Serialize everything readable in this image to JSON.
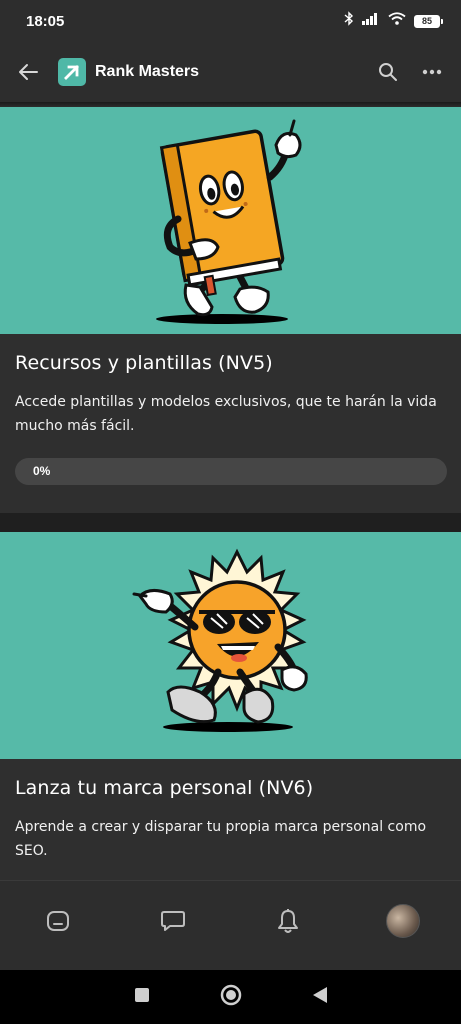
{
  "status_bar": {
    "time": "18:05",
    "battery": "85",
    "icons": [
      "bluetooth-icon",
      "signal-icon",
      "wifi-icon",
      "battery-icon"
    ]
  },
  "app_bar": {
    "title": "Rank Masters",
    "icons": [
      "back-arrow-icon",
      "app-logo-icon",
      "search-icon",
      "more-icon"
    ]
  },
  "cards": [
    {
      "title": "Recursos y plantillas (NV5)",
      "description": "Accede plantillas y modelos exclusivos, que te harán la vida mucho más fácil.",
      "progress_label": "0%",
      "progress": 0,
      "illustration": "book-mascot"
    },
    {
      "title": "Lanza tu marca personal (NV6)",
      "description": "Aprende a crear y disparar tu propia marca personal como SEO.",
      "illustration": "sun-mascot"
    }
  ],
  "bottom_nav": [
    "home-icon",
    "chat-icon",
    "bell-icon",
    "avatar"
  ],
  "system_nav": [
    "square-icon",
    "circle-icon",
    "triangle-back-icon"
  ],
  "colors": {
    "hero_bg": "#56baa8",
    "card_bg": "#2f2f2f",
    "bar_bg": "#2d2d2d",
    "book": "#f5a623",
    "sun": "#f7a32a"
  }
}
